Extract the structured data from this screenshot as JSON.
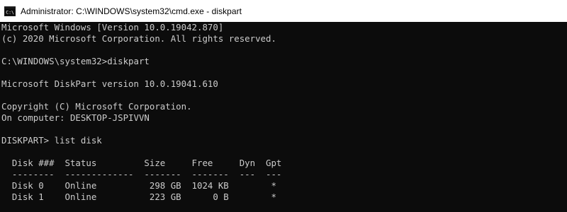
{
  "window": {
    "title": "Administrator: C:\\WINDOWS\\system32\\cmd.exe - diskpart",
    "icon": "cmd-icon"
  },
  "colors": {
    "console_background": "#0c0c0c",
    "console_text": "#cccccc",
    "titlebar_background": "#ffffff"
  },
  "console": {
    "lines": [
      "Microsoft Windows [Version 10.0.19042.870]",
      "(c) 2020 Microsoft Corporation. All rights reserved.",
      "",
      "C:\\WINDOWS\\system32>diskpart",
      "",
      "Microsoft DiskPart version 10.0.19041.610",
      "",
      "Copyright (C) Microsoft Corporation.",
      "On computer: DESKTOP-JSPIVVN",
      "",
      "DISKPART> list disk",
      "",
      "  Disk ###  Status         Size     Free     Dyn  Gpt",
      "  --------  -------------  -------  -------  ---  ---",
      "  Disk 0    Online          298 GB  1024 KB        *",
      "  Disk 1    Online          223 GB      0 B        *"
    ]
  }
}
